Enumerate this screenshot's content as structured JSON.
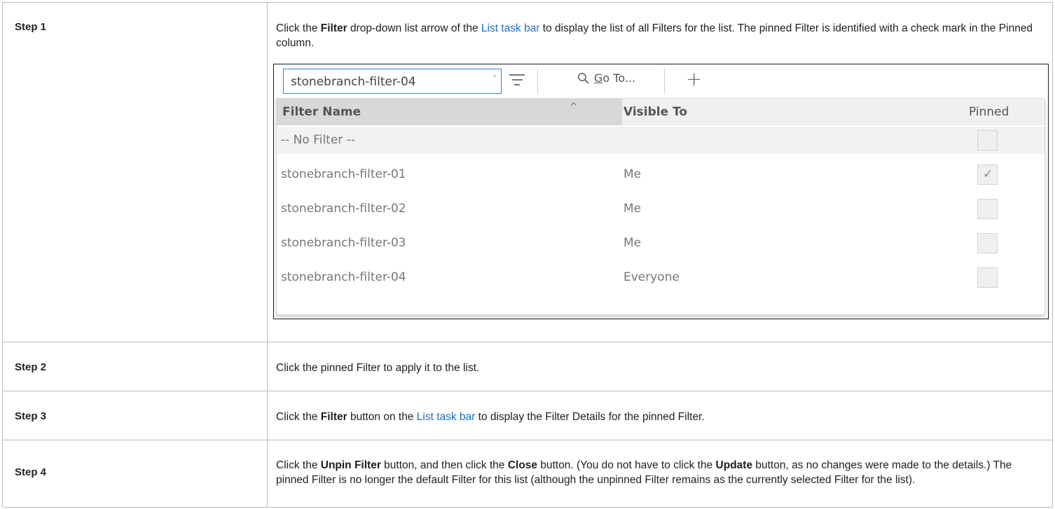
{
  "steps": [
    {
      "label": "Step 1",
      "parts": [
        {
          "t": "Click the "
        },
        {
          "t": "Filter",
          "b": true
        },
        {
          "t": " drop-down list arrow of the "
        },
        {
          "t": "List task bar",
          "link": true
        },
        {
          "t": " to display the list of all Filters for the list. The pinned Filter is identified with a check mark in the Pinned column."
        }
      ]
    },
    {
      "label": "Step 2",
      "parts": [
        {
          "t": "Click the pinned Filter to apply it to the list."
        }
      ]
    },
    {
      "label": "Step 3",
      "parts": [
        {
          "t": "Click the "
        },
        {
          "t": "Filter",
          "b": true
        },
        {
          "t": " button on the "
        },
        {
          "t": "List task bar",
          "link": true
        },
        {
          "t": " to display the Filter Details for the pinned Filter."
        }
      ]
    },
    {
      "label": "Step 4",
      "parts": [
        {
          "t": "Click the "
        },
        {
          "t": "Unpin Filter",
          "b": true
        },
        {
          "t": " button, and then click the "
        },
        {
          "t": "Close",
          "b": true
        },
        {
          "t": " button. (You do not have to click the "
        },
        {
          "t": "Update",
          "b": true
        },
        {
          "t": " button, as no changes were made to the details.) The pinned Filter is no longer the default Filter for this list (although the unpinned Filter remains as the currently selected Filter for the list)."
        }
      ]
    }
  ],
  "screenshot": {
    "filter_value": "stonebranch-filter-04",
    "goto_prefix": "",
    "goto_underlined": "G",
    "goto_rest": "o To...",
    "plus_glyph": "+",
    "dropdown_arrow": "˅",
    "sort_caret": "^",
    "check_glyph": "✓",
    "columns": {
      "name": "Filter Name",
      "visible": "Visible To",
      "pinned": "Pinned"
    },
    "rows": [
      {
        "name": "-- No Filter --",
        "visible": "",
        "pinned": false
      },
      {
        "name": "stonebranch-filter-01",
        "visible": "Me",
        "pinned": true
      },
      {
        "name": "stonebranch-filter-02",
        "visible": "Me",
        "pinned": false
      },
      {
        "name": "stonebranch-filter-03",
        "visible": "Me",
        "pinned": false
      },
      {
        "name": "stonebranch-filter-04",
        "visible": "Everyone",
        "pinned": false
      }
    ]
  },
  "colors": {
    "link": "#1a6fd6",
    "focus_border": "#2f86d6",
    "table_border": "#b8bcc8"
  }
}
